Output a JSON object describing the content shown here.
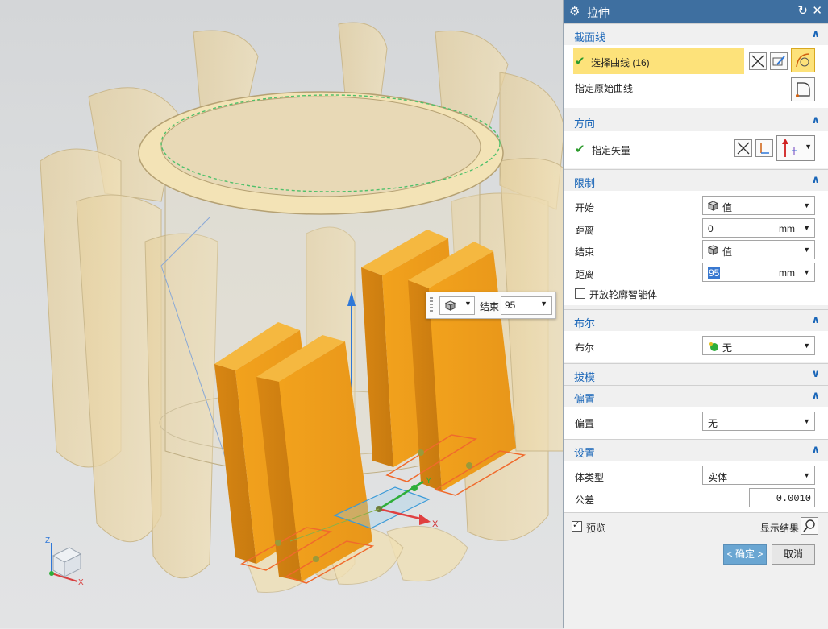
{
  "dialog": {
    "title": "拉伸",
    "sections": {
      "section_curve": {
        "label": "截面线",
        "select_curve": "选择曲线 (16)",
        "specify_origin_curve": "指定原始曲线"
      },
      "direction": {
        "label": "方向",
        "specify_vector": "指定矢量"
      },
      "limits": {
        "label": "限制",
        "start_label": "开始",
        "start_type": "值",
        "start_distance_label": "距离",
        "start_distance": "0",
        "end_label": "结束",
        "end_type": "值",
        "end_distance_label": "距离",
        "end_distance": "95",
        "unit": "mm",
        "open_profile_label": "开放轮廓智能体"
      },
      "boolean": {
        "label": "布尔",
        "boolean_label": "布尔",
        "boolean_value": "无"
      },
      "draft": {
        "label": "拔模"
      },
      "offset": {
        "label": "偏置",
        "offset_label": "偏置",
        "offset_value": "无"
      },
      "settings": {
        "label": "设置",
        "body_type_label": "体类型",
        "body_type_value": "实体",
        "tolerance_label": "公差",
        "tolerance_value": "0.0010"
      }
    },
    "preview_label": "预览",
    "show_result_label": "显示结果",
    "ok_label": "< 确定 >",
    "cancel_label": "取消"
  },
  "viewport": {
    "float_bar": {
      "end_label": "结束",
      "end_value": "95"
    },
    "axes": {
      "x": "X",
      "y": "Y",
      "z": "Z"
    }
  },
  "colors": {
    "titlebar": "#3e6fa0",
    "section_label": "#1a66b8",
    "selected_row": "#fde27a",
    "solid_orange": "#f0a020",
    "ghost_part": "#e8cf98"
  }
}
